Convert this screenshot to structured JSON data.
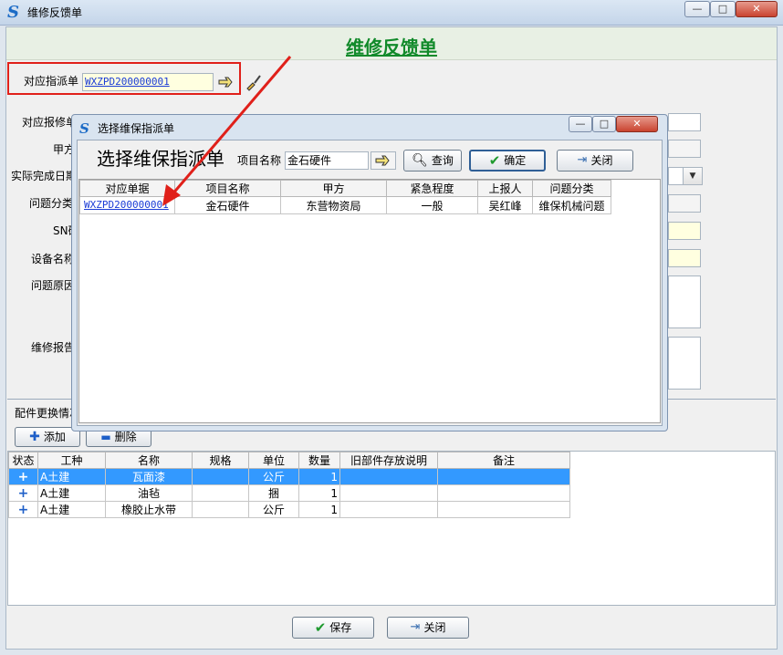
{
  "window": {
    "title": "维修反馈单",
    "min": "—",
    "max": "□",
    "close": "✕"
  },
  "form": {
    "title": "维修反馈单",
    "dispatch_label": "对应指派单",
    "dispatch_value": "WXZPD200000001",
    "repair_label": "对应报修单",
    "party_label": "甲方",
    "finish_label": "实际完成日期",
    "category_label": "问题分类",
    "sn_label": "SN码",
    "device_label": "设备名称",
    "cause_label": "问题原因",
    "report_label": "维修报告",
    "parts_tab": "配件更换情况",
    "add_btn": "添加",
    "delete_btn": "删除",
    "save_btn": "保存",
    "close_btn": "关闭"
  },
  "parts_table": {
    "columns": [
      "状态",
      "工种",
      "名称",
      "规格",
      "单位",
      "数量",
      "旧部件存放说明",
      "备注"
    ],
    "rows": [
      {
        "status": "+",
        "type": "A土建",
        "name": "瓦面漆",
        "spec": "",
        "unit": "公斤",
        "qty": "1",
        "old": "",
        "note": ""
      },
      {
        "status": "+",
        "type": "A土建",
        "name": "油毡",
        "spec": "",
        "unit": "捆",
        "qty": "1",
        "old": "",
        "note": ""
      },
      {
        "status": "+",
        "type": "A土建",
        "name": "橡胶止水带",
        "spec": "",
        "unit": "公斤",
        "qty": "1",
        "old": "",
        "note": ""
      }
    ]
  },
  "dialog": {
    "title": "选择维保指派单",
    "heading": "选择维保指派单",
    "project_label": "项目名称",
    "project_value": "金石硬件",
    "query_btn": "查询",
    "ok_btn": "确定",
    "close_btn": "关闭",
    "columns": [
      "对应单据",
      "项目名称",
      "甲方",
      "紧急程度",
      "上报人",
      "问题分类"
    ],
    "rows": [
      {
        "doc": "WXZPD200000001",
        "project": "金石硬件",
        "party": "东营物资局",
        "urgency": "一般",
        "reporter": "吴红峰",
        "category": "维保机械问题"
      }
    ]
  },
  "colors": {
    "accent_green": "#118a2a",
    "highlight_red": "#e0201a",
    "selection_blue": "#3399ff"
  }
}
